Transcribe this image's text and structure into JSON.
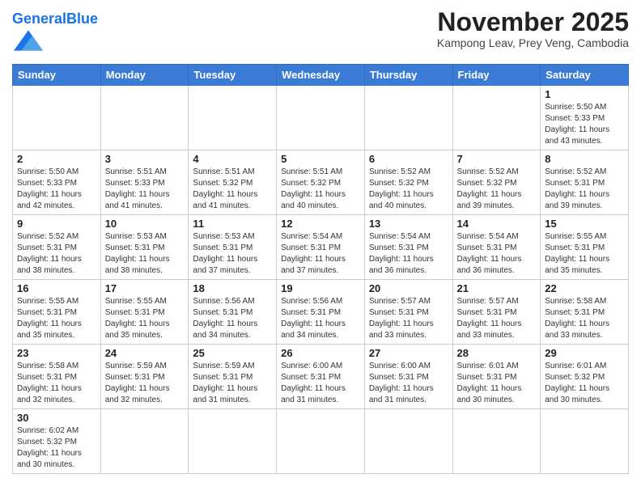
{
  "header": {
    "logo_general": "General",
    "logo_blue": "Blue",
    "month_title": "November 2025",
    "location": "Kampong Leav, Prey Veng, Cambodia"
  },
  "days_of_week": [
    "Sunday",
    "Monday",
    "Tuesday",
    "Wednesday",
    "Thursday",
    "Friday",
    "Saturday"
  ],
  "weeks": [
    [
      {
        "day": "",
        "info": ""
      },
      {
        "day": "",
        "info": ""
      },
      {
        "day": "",
        "info": ""
      },
      {
        "day": "",
        "info": ""
      },
      {
        "day": "",
        "info": ""
      },
      {
        "day": "",
        "info": ""
      },
      {
        "day": "1",
        "info": "Sunrise: 5:50 AM\nSunset: 5:33 PM\nDaylight: 11 hours\nand 43 minutes."
      }
    ],
    [
      {
        "day": "2",
        "info": "Sunrise: 5:50 AM\nSunset: 5:33 PM\nDaylight: 11 hours\nand 42 minutes."
      },
      {
        "day": "3",
        "info": "Sunrise: 5:51 AM\nSunset: 5:33 PM\nDaylight: 11 hours\nand 41 minutes."
      },
      {
        "day": "4",
        "info": "Sunrise: 5:51 AM\nSunset: 5:32 PM\nDaylight: 11 hours\nand 41 minutes."
      },
      {
        "day": "5",
        "info": "Sunrise: 5:51 AM\nSunset: 5:32 PM\nDaylight: 11 hours\nand 40 minutes."
      },
      {
        "day": "6",
        "info": "Sunrise: 5:52 AM\nSunset: 5:32 PM\nDaylight: 11 hours\nand 40 minutes."
      },
      {
        "day": "7",
        "info": "Sunrise: 5:52 AM\nSunset: 5:32 PM\nDaylight: 11 hours\nand 39 minutes."
      },
      {
        "day": "8",
        "info": "Sunrise: 5:52 AM\nSunset: 5:31 PM\nDaylight: 11 hours\nand 39 minutes."
      }
    ],
    [
      {
        "day": "9",
        "info": "Sunrise: 5:52 AM\nSunset: 5:31 PM\nDaylight: 11 hours\nand 38 minutes."
      },
      {
        "day": "10",
        "info": "Sunrise: 5:53 AM\nSunset: 5:31 PM\nDaylight: 11 hours\nand 38 minutes."
      },
      {
        "day": "11",
        "info": "Sunrise: 5:53 AM\nSunset: 5:31 PM\nDaylight: 11 hours\nand 37 minutes."
      },
      {
        "day": "12",
        "info": "Sunrise: 5:54 AM\nSunset: 5:31 PM\nDaylight: 11 hours\nand 37 minutes."
      },
      {
        "day": "13",
        "info": "Sunrise: 5:54 AM\nSunset: 5:31 PM\nDaylight: 11 hours\nand 36 minutes."
      },
      {
        "day": "14",
        "info": "Sunrise: 5:54 AM\nSunset: 5:31 PM\nDaylight: 11 hours\nand 36 minutes."
      },
      {
        "day": "15",
        "info": "Sunrise: 5:55 AM\nSunset: 5:31 PM\nDaylight: 11 hours\nand 35 minutes."
      }
    ],
    [
      {
        "day": "16",
        "info": "Sunrise: 5:55 AM\nSunset: 5:31 PM\nDaylight: 11 hours\nand 35 minutes."
      },
      {
        "day": "17",
        "info": "Sunrise: 5:55 AM\nSunset: 5:31 PM\nDaylight: 11 hours\nand 35 minutes."
      },
      {
        "day": "18",
        "info": "Sunrise: 5:56 AM\nSunset: 5:31 PM\nDaylight: 11 hours\nand 34 minutes."
      },
      {
        "day": "19",
        "info": "Sunrise: 5:56 AM\nSunset: 5:31 PM\nDaylight: 11 hours\nand 34 minutes."
      },
      {
        "day": "20",
        "info": "Sunrise: 5:57 AM\nSunset: 5:31 PM\nDaylight: 11 hours\nand 33 minutes."
      },
      {
        "day": "21",
        "info": "Sunrise: 5:57 AM\nSunset: 5:31 PM\nDaylight: 11 hours\nand 33 minutes."
      },
      {
        "day": "22",
        "info": "Sunrise: 5:58 AM\nSunset: 5:31 PM\nDaylight: 11 hours\nand 33 minutes."
      }
    ],
    [
      {
        "day": "23",
        "info": "Sunrise: 5:58 AM\nSunset: 5:31 PM\nDaylight: 11 hours\nand 32 minutes."
      },
      {
        "day": "24",
        "info": "Sunrise: 5:59 AM\nSunset: 5:31 PM\nDaylight: 11 hours\nand 32 minutes."
      },
      {
        "day": "25",
        "info": "Sunrise: 5:59 AM\nSunset: 5:31 PM\nDaylight: 11 hours\nand 31 minutes."
      },
      {
        "day": "26",
        "info": "Sunrise: 6:00 AM\nSunset: 5:31 PM\nDaylight: 11 hours\nand 31 minutes."
      },
      {
        "day": "27",
        "info": "Sunrise: 6:00 AM\nSunset: 5:31 PM\nDaylight: 11 hours\nand 31 minutes."
      },
      {
        "day": "28",
        "info": "Sunrise: 6:01 AM\nSunset: 5:31 PM\nDaylight: 11 hours\nand 30 minutes."
      },
      {
        "day": "29",
        "info": "Sunrise: 6:01 AM\nSunset: 5:32 PM\nDaylight: 11 hours\nand 30 minutes."
      }
    ],
    [
      {
        "day": "30",
        "info": "Sunrise: 6:02 AM\nSunset: 5:32 PM\nDaylight: 11 hours\nand 30 minutes."
      },
      {
        "day": "",
        "info": ""
      },
      {
        "day": "",
        "info": ""
      },
      {
        "day": "",
        "info": ""
      },
      {
        "day": "",
        "info": ""
      },
      {
        "day": "",
        "info": ""
      },
      {
        "day": "",
        "info": ""
      }
    ]
  ]
}
